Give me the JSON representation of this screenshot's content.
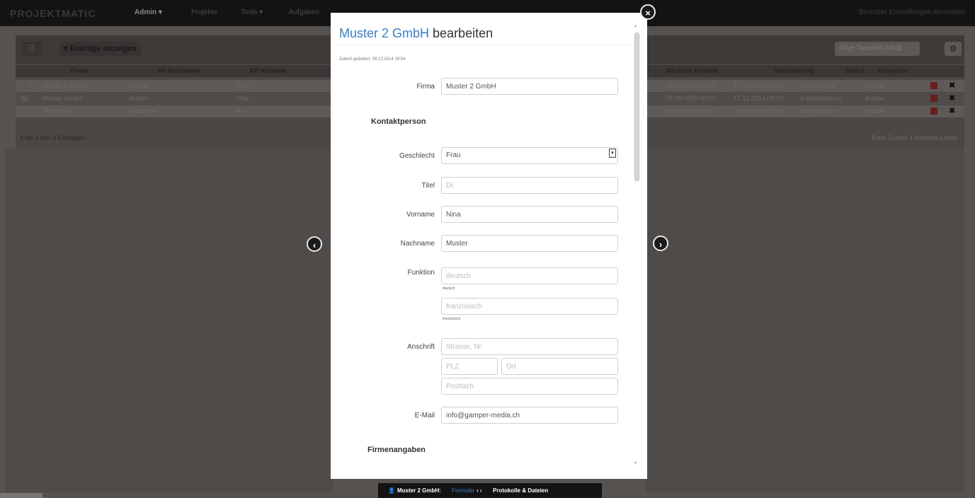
{
  "background": {
    "brand": "PROJEKTMATIC",
    "menu": [
      "Admin ▾",
      "Projekte",
      "Tools ▾",
      "Aufgaben"
    ],
    "user": "Benutzer  Einstellungen  Abmelden",
    "panel_icon": "☷",
    "entries_button": "▾ Einträge anzeigen",
    "filter_placeholder": "Filter Tabellen Inhalt",
    "gear_icon": "gear-icon",
    "columns": [
      "Firma",
      "AP Nachname",
      "AP Vorname",
      "Nächster Kontakt",
      "Veränderung",
      "Status",
      "Kategorie"
    ],
    "rows": [
      {
        "firma": "Muster 2 GmbH",
        "nachname": "Muster",
        "vorname": "Nina",
        "kontakt": "08.08.0000 00:00",
        "veraenderung": "17.12.2014 09:00",
        "status": "unbearbeitet",
        "kategorie": "Kunde"
      },
      {
        "firma": "Muster GmbH",
        "nachname": "Muster",
        "vorname": "Max",
        "kontakt": "08.08.0000 00:00",
        "veraenderung": "17.12.2014 09:00",
        "status": "in Bearbeitung",
        "kategorie": "Kunde"
      },
      {
        "firma": "Testfirma",
        "nachname": "Testname",
        "vorname": "Ali",
        "kontakt": "08.08.0000 00:00",
        "veraenderung": "08.08.0000 00:00",
        "status": "unbearbeitet",
        "kategorie": "Kunde"
      }
    ],
    "footer": "1 bis 3 von 3 Einträgen",
    "pager": "Erste  Zurück  1  Nächste  Letzte"
  },
  "modal": {
    "title_company": "Muster 2 GmbH",
    "title_suffix": " bearbeiten",
    "saved_note": "Zuletzt geändert: 09.12.2014 19:54",
    "sections": {
      "kontakt": "Kontaktperson",
      "firma": "Firmenangaben"
    },
    "fields": {
      "firma": {
        "label": "Firma",
        "value": "Muster 2 GmbH"
      },
      "geschlecht": {
        "label": "Geschlecht",
        "value": "Frau"
      },
      "titel": {
        "label": "Titel",
        "placeholder": "Dr."
      },
      "vorname": {
        "label": "Vorname",
        "value": "Nina"
      },
      "nachname": {
        "label": "Nachname",
        "value": "Muster"
      },
      "funktion": {
        "label": "Funktion",
        "placeholder_de": "deutsch",
        "help_de": "deutsch",
        "placeholder_fr": "französisch",
        "help_fr": "französisch"
      },
      "anschrift": {
        "label": "Anschrift",
        "strasse_placeholder": "Strasse, Nr.",
        "plz_placeholder": "PLZ",
        "ort_placeholder": "Ort",
        "postfach_placeholder": "Postfach"
      },
      "email": {
        "label": "E-Mail",
        "value": "info@gamper-media.ch"
      }
    }
  },
  "nav": {
    "close": "×",
    "prev": "‹",
    "next": "›"
  },
  "tabbar": {
    "user_icon": "user-icon",
    "company": "Muster 2 GmbH:",
    "form": "Formular",
    "arrows": "‹ ›",
    "protocols": "Protokolle & Dateien"
  }
}
